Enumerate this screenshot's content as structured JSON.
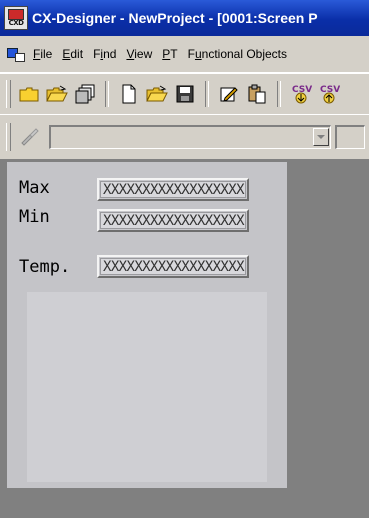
{
  "window": {
    "title": "CX-Designer - NewProject - [0001:Screen P"
  },
  "app_icon": {
    "label": "CXD"
  },
  "menu": [
    {
      "pre": "",
      "key": "F",
      "post": "ile"
    },
    {
      "pre": "",
      "key": "E",
      "post": "dit"
    },
    {
      "pre": "F",
      "key": "i",
      "post": "nd"
    },
    {
      "pre": "",
      "key": "V",
      "post": "iew"
    },
    {
      "pre": "",
      "key": "P",
      "post": "T"
    },
    {
      "pre": "F",
      "key": "u",
      "post": "nctional Objects"
    }
  ],
  "toolbar_icons": [
    "folder-icon",
    "open-folder-icon",
    "copy-screens-icon",
    "new-document-icon",
    "open-icon",
    "save-icon",
    "edit-icon",
    "paste-icon",
    "csv-import-icon",
    "csv-export-icon"
  ],
  "csv": {
    "label": "csv"
  },
  "screen": {
    "labels": {
      "max": "Max",
      "min": "Min",
      "temp": "Temp."
    },
    "field_text": "XXXXXXXXXXXXXXXXXX"
  },
  "colors": {
    "titlebar": "#0a2ea8",
    "workspace": "#808080",
    "screen": "#c4c4c8",
    "panel": "#cfcfd3"
  }
}
